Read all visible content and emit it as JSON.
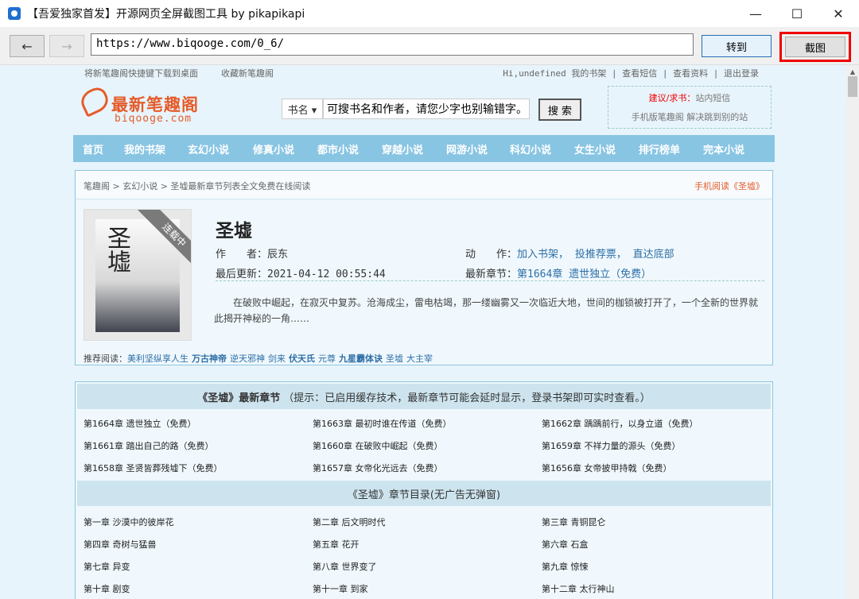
{
  "window": {
    "title": "【吾爱独家首发】开源网页全屏截图工具 by pikapikapi",
    "minimize": "—",
    "maximize": "☐",
    "close": "✕"
  },
  "toolbar": {
    "back": "←",
    "forward": "→",
    "url": "https://www.biqooge.com/0_6/",
    "go_label": "转到",
    "screenshot_label": "截图"
  },
  "site": {
    "top_left_1": "将新笔趣阁快捷键下载到桌面",
    "top_left_2": "收藏新笔趣阁",
    "top_right": "Hi,undefined  我的书架 | 查看短信 | 查看资料 | 退出登录",
    "logo_name": "最新笔趣阁",
    "logo_domain": "biqooge.com",
    "search_select": "书名 ▾",
    "search_placeholder": "可搜书名和作者，请您少字也别输错字。",
    "search_button": "搜 索",
    "suggest_1a": "建议/求书：",
    "suggest_1b": "站内短信",
    "suggest_2": "手机版笔趣阁  解决跳到别的站",
    "nav": [
      "首页",
      "我的书架",
      "玄幻小说",
      "修真小说",
      "都市小说",
      "穿越小说",
      "网游小说",
      "科幻小说",
      "女生小说",
      "排行榜单",
      "完本小说"
    ]
  },
  "book": {
    "breadcrumb": "笔趣阁 > 玄幻小说 > 圣墟最新章节列表全文免费在线阅读",
    "mobile_read": "手机阅读《圣墟》",
    "cover_text": "圣墟",
    "ribbon": "连载中",
    "title": "圣墟",
    "author_label": "作　　者：",
    "author": "辰东",
    "action_label": "动　　作：",
    "actions": "加入书架， 投推荐票， 直达底部",
    "update_label": "最后更新：",
    "update_time": "2021-04-12 00:55:44",
    "latest_label": "最新章节：",
    "latest_chapter": "第1664章 遗世独立（免费）",
    "description": "在破败中崛起，在寂灭中复苏。沧海成尘，雷电枯竭，那一缕幽雾又一次临近大地，世间的枷锁被打开了，一个全新的世界就此揭开神秘的一角……",
    "rec_label": "推荐阅读：",
    "recommend": [
      "美利坚纵享人生",
      "万古神帝",
      "逆天邪神",
      "剑来",
      "伏天氏",
      "元尊",
      "九星霸体诀",
      "圣墟",
      "大主宰"
    ]
  },
  "latest": {
    "header_bold": "《圣墟》最新章节",
    "header_note": "（提示：已启用缓存技术，最新章节可能会延时显示，登录书架即可实时查看。）",
    "chapters": [
      "第1664章 遗世独立（免费）",
      "第1663章 最初时谁在传道（免费）",
      "第1662章 踽踽前行，以身立道（免费）",
      "第1661章 踏出自己的路（免费）",
      "第1660章 在破败中崛起（免费）",
      "第1659章 不祥力量的源头（免费）",
      "第1658章 圣贤皆葬残墟下（免费）",
      "第1657章 女帝化光远去（免费）",
      "第1656章 女帝披甲持戟（免费）"
    ]
  },
  "catalog": {
    "header": "《圣墟》章节目录(无广告无弹窗)",
    "chapters": [
      "第一章 沙漠中的彼岸花",
      "第二章 后文明时代",
      "第三章 青铜昆仑",
      "第四章 奇树与猛兽",
      "第五章 花开",
      "第六章 石盒",
      "第七章 异变",
      "第八章 世界变了",
      "第九章 惊悚",
      "第十章 剧变",
      "第十一章 到家",
      "第十二章 太行神山"
    ]
  }
}
